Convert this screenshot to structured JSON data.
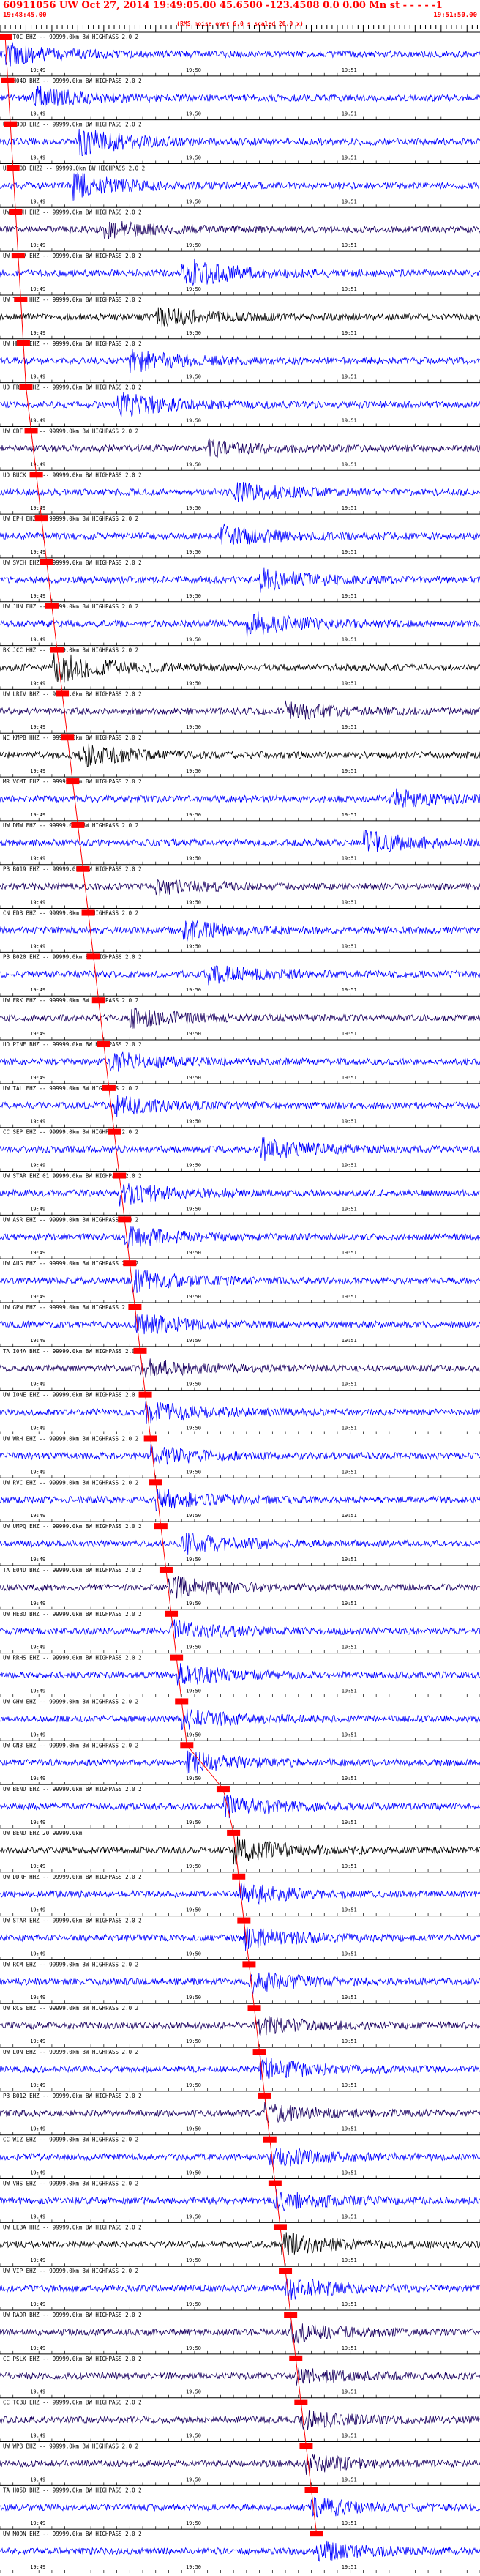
{
  "header": {
    "title": "60911056 UW Oct 27, 2014 19:49:05.00   45.6500  -123.4508  0.0 0.00 Mn st - - - - -1",
    "start_time": "19:48:45.00",
    "end_time": "19:51:50.00",
    "rms_note": "(RMS noise over 6.0 s scaled 20.0 x)"
  },
  "colors": {
    "trace_blue": "#0000ff",
    "trace_black": "#000000",
    "trace_purple": "#1a0060",
    "pick_red": "#ff0000",
    "tick_black": "#000000"
  },
  "chart_data": {
    "type": "seismogram-record-section",
    "x_range_seconds": [
      0,
      185
    ],
    "time_tick_labels": [
      "19:49",
      "19:50",
      "19:51"
    ],
    "time_tick_offsets_s": [
      15,
      75,
      135
    ],
    "traces": [
      {
        "label": "CN TOC BHZ -- 99999.0km BW  HIGHPASS  2.0  2",
        "color": "blue",
        "pick_s": 2,
        "amp": 0.55,
        "event_s": 2
      },
      {
        "label": "TA H04D BHZ -- 99999.0km BW  HIGHPASS  2.0  2",
        "color": "blue",
        "pick_s": 3,
        "amp": 0.6,
        "event_s": 12
      },
      {
        "label": "UO HOOD EHZ -- 99999.0km BW  HIGHPASS  2.0  2",
        "color": "blue",
        "pick_s": 4,
        "amp": 0.7,
        "event_s": 30
      },
      {
        "label": "UO HOOD EHZ2 -- 99999.0km BW  HIGHPASS  2.0  2",
        "color": "blue",
        "pick_s": 5,
        "amp": 0.65,
        "event_s": 28
      },
      {
        "label": "UW SPUH EHZ -- 99999.0km BW  HIGHPASS  2.0  2",
        "color": "purple",
        "pick_s": 6,
        "amp": 0.4,
        "event_s": 40
      },
      {
        "label": "UW JORV EHZ -- 99999.0km BW  HIGHPASS  2.0  2",
        "color": "blue",
        "pick_s": 7,
        "amp": 0.8,
        "event_s": 70
      },
      {
        "label": "UW TUCA HHZ -- 99999.0km BW  HIGHPASS  2.0  2",
        "color": "black",
        "pick_s": 8,
        "amp": 0.5,
        "event_s": 60
      },
      {
        "label": "UW HMRT EHZ -- 99999.0km BW  HIGHPASS  2.0  2",
        "color": "blue",
        "pick_s": 9,
        "amp": 0.6,
        "event_s": 50
      },
      {
        "label": "UO FRIS EHZ -- 99999.0km BW  HIGHPASS  2.0  2",
        "color": "blue",
        "pick_s": 10,
        "amp": 0.65,
        "event_s": 45
      },
      {
        "label": "UW CDF EHZ -- 99999.0km BW  HIGHPASS  2.0  2",
        "color": "purple",
        "pick_s": 12,
        "amp": 0.35,
        "event_s": 80
      },
      {
        "label": "UO BUCK BHZ -- 99999.0km BW  HIGHPASS  2.0  2",
        "color": "blue",
        "pick_s": 14,
        "amp": 0.5,
        "event_s": 90
      },
      {
        "label": "UW EPH EHZ -- 99999.0km BW  HIGHPASS  2.0  2",
        "color": "blue",
        "pick_s": 16,
        "amp": 0.55,
        "event_s": 85
      },
      {
        "label": "UW SVCH EHZ -- 99999.0km BW  HIGHPASS  2.0  2",
        "color": "blue",
        "pick_s": 18,
        "amp": 0.55,
        "event_s": 100
      },
      {
        "label": "UW JUN EHZ -- 99999.0km BW  HIGHPASS  2.0  2",
        "color": "blue",
        "pick_s": 20,
        "amp": 0.6,
        "event_s": 95
      },
      {
        "label": "BK JCC HHZ -- 99999.0km BW  HIGHPASS  2.0  2",
        "color": "black",
        "pick_s": 22,
        "amp": 0.85,
        "event_s": 20
      },
      {
        "label": "UW LRIV BHZ -- 99999.0km BW  HIGHPASS  2.0  2",
        "color": "purple",
        "pick_s": 24,
        "amp": 0.45,
        "event_s": 110
      },
      {
        "label": "NC KMPB HHZ -- 99999.0km BW  HIGHPASS  2.0  2",
        "color": "black",
        "pick_s": 26,
        "amp": 0.6,
        "event_s": 30
      },
      {
        "label": "MR VCMT EHZ -- 99999.0km BW  HIGHPASS  2.0  2",
        "color": "blue",
        "pick_s": 28,
        "amp": 0.5,
        "event_s": 150
      },
      {
        "label": "UW DMW EHZ -- 99999.0km BW  HIGHPASS  2.0  2",
        "color": "blue",
        "pick_s": 30,
        "amp": 0.55,
        "event_s": 140
      },
      {
        "label": "PB B019 EHZ -- 99999.0km BW  HIGHPASS  2.0  2",
        "color": "purple",
        "pick_s": 32,
        "amp": 0.4,
        "event_s": 60
      },
      {
        "label": "CN EDB BHZ -- 99999.0km BW  HIGHPASS  2.0  2",
        "color": "blue",
        "pick_s": 34,
        "amp": 0.5,
        "event_s": 70
      },
      {
        "label": "PB B020 EHZ -- 99999.0km BW  HIGHPASS  2.0  2",
        "color": "blue",
        "pick_s": 36,
        "amp": 0.45,
        "event_s": 80
      },
      {
        "label": "UW FRK EHZ -- 99999.0km BW  HIGHPASS  2.0  2",
        "color": "purple",
        "pick_s": 38,
        "amp": 0.45,
        "event_s": 50
      },
      {
        "label": "UO PINE BHZ -- 99999.0km BW  HIGHPASS  2.0  2",
        "color": "blue",
        "pick_s": 40,
        "amp": 0.55,
        "event_s": 42
      },
      {
        "label": "UW TAL EHZ -- 99999.0km BW  HIGHPASS  2.0  2",
        "color": "blue",
        "pick_s": 42,
        "amp": 0.5,
        "event_s": 44
      },
      {
        "label": "CC SEP EHZ -- 99999.0km BW  HIGHPASS  2.0  2",
        "color": "blue",
        "pick_s": 44,
        "amp": 0.55,
        "event_s": 100
      },
      {
        "label": "UW STAR EHZ 01 99999.0km BW  HIGHPASS  2.0  2",
        "color": "blue",
        "pick_s": 46,
        "amp": 0.6,
        "event_s": 46
      },
      {
        "label": "UW ASR EHZ -- 99999.0km BW  HIGHPASS  2.0  2",
        "color": "blue",
        "pick_s": 48,
        "amp": 0.55,
        "event_s": 48
      },
      {
        "label": "UW AUG EHZ -- 99999.0km BW  HIGHPASS  2.0  2",
        "color": "blue",
        "pick_s": 50,
        "amp": 0.55,
        "event_s": 50
      },
      {
        "label": "UW GPW EHZ -- 99999.0km BW  HIGHPASS  2.0  2",
        "color": "blue",
        "pick_s": 52,
        "amp": 0.55,
        "event_s": 52
      },
      {
        "label": "TA I04A BHZ -- 99999.0km BW  HIGHPASS  2.0  2",
        "color": "purple",
        "pick_s": 54,
        "amp": 0.45,
        "event_s": 54
      },
      {
        "label": "UW IONE EHZ -- 99999.0km BW  HIGHPASS  2.0  2",
        "color": "blue",
        "pick_s": 56,
        "amp": 0.55,
        "event_s": 56
      },
      {
        "label": "UW WRH EHZ -- 99999.0km BW  HIGHPASS  2.0  2",
        "color": "blue",
        "pick_s": 58,
        "amp": 0.5,
        "event_s": 58
      },
      {
        "label": "UW RVC EHZ -- 99999.0km BW  HIGHPASS  2.0  2",
        "color": "blue",
        "pick_s": 60,
        "amp": 0.5,
        "event_s": 60
      },
      {
        "label": "UW UMPQ EHZ -- 99999.0km BW  HIGHPASS  2.0  2",
        "color": "blue",
        "pick_s": 62,
        "amp": 0.55,
        "event_s": 70
      },
      {
        "label": "TA E04D BHZ -- 99999.0km BW  HIGHPASS  2.0  2",
        "color": "purple",
        "pick_s": 64,
        "amp": 0.6,
        "event_s": 64
      },
      {
        "label": "UW HEBO BHZ -- 99999.0km BW  HIGHPASS  2.0  2",
        "color": "blue",
        "pick_s": 66,
        "amp": 0.5,
        "event_s": 66
      },
      {
        "label": "UW RRHS EHZ -- 99999.0km BW  HIGHPASS  2.0  2",
        "color": "blue",
        "pick_s": 68,
        "amp": 0.55,
        "event_s": 68
      },
      {
        "label": "UW GHW EHZ -- 99999.0km BW  HIGHPASS  2.0  2",
        "color": "blue",
        "pick_s": 70,
        "amp": 0.5,
        "event_s": 70
      },
      {
        "label": "UW GN3 EHZ -- 99999.0km BW  HIGHPASS  2.0  2",
        "color": "blue",
        "pick_s": 72,
        "amp": 0.55,
        "event_s": 72
      },
      {
        "label": "UW BEND EHZ -- 99999.0km BW  HIGHPASS  2.0  2",
        "color": "blue",
        "pick_s": 86,
        "amp": 0.55,
        "event_s": 86
      },
      {
        "label": "UW BEND EHZ 20 99999.0km",
        "color": "black",
        "pick_s": 90,
        "amp": 0.7,
        "event_s": 90
      },
      {
        "label": "UW DDRF HHZ -- 99999.0km BW  HIGHPASS  2.0  2",
        "color": "blue",
        "pick_s": 92,
        "amp": 0.55,
        "event_s": 92
      },
      {
        "label": "UW STAR EHZ -- 99999.0km BW  HIGHPASS  2.0  2",
        "color": "blue",
        "pick_s": 94,
        "amp": 0.55,
        "event_s": 94
      },
      {
        "label": "UW RCM EHZ -- 99999.0km BW  HIGHPASS  2.0  2",
        "color": "blue",
        "pick_s": 96,
        "amp": 0.55,
        "event_s": 96
      },
      {
        "label": "UW RCS EHZ -- 99999.0km BW  HIGHPASS  2.0  2",
        "color": "purple",
        "pick_s": 98,
        "amp": 0.5,
        "event_s": 98
      },
      {
        "label": "UW LON BHZ -- 99999.0km BW  HIGHPASS  2.0  2",
        "color": "blue",
        "pick_s": 100,
        "amp": 0.6,
        "event_s": 100
      },
      {
        "label": "PB B012 EHZ -- 99999.0km BW  HIGHPASS  2.0  2",
        "color": "purple",
        "pick_s": 102,
        "amp": 0.45,
        "event_s": 102
      },
      {
        "label": "CC WIZ EHZ -- 99999.0km BW  HIGHPASS  2.0  2",
        "color": "blue",
        "pick_s": 104,
        "amp": 0.55,
        "event_s": 104
      },
      {
        "label": "UW VHS EHZ -- 99999.0km BW  HIGHPASS  2.0  2",
        "color": "blue",
        "pick_s": 106,
        "amp": 0.5,
        "event_s": 106
      },
      {
        "label": "UW LEBA HHZ -- 99999.0km BW  HIGHPASS  2.0  2",
        "color": "black",
        "pick_s": 108,
        "amp": 0.6,
        "event_s": 108
      },
      {
        "label": "UW VIP EHZ -- 99999.0km BW  HIGHPASS  2.0  2",
        "color": "blue",
        "pick_s": 110,
        "amp": 0.55,
        "event_s": 110
      },
      {
        "label": "UW RADR BHZ -- 99999.0km BW  HIGHPASS  2.0  2",
        "color": "purple",
        "pick_s": 112,
        "amp": 0.5,
        "event_s": 112
      },
      {
        "label": "CC PSLK EHZ -- 99999.0km BW  HIGHPASS  2.0  2",
        "color": "purple",
        "pick_s": 114,
        "amp": 0.45,
        "event_s": 114
      },
      {
        "label": "CC TCBU EHZ -- 99999.0km BW  HIGHPASS  2.0  2",
        "color": "purple",
        "pick_s": 116,
        "amp": 0.45,
        "event_s": 116
      },
      {
        "label": "UW WPB BHZ -- 99999.0km BW  HIGHPASS  2.0  2",
        "color": "purple",
        "pick_s": 118,
        "amp": 0.45,
        "event_s": 118
      },
      {
        "label": "TA H05D BHZ -- 99999.0km BW  HIGHPASS  2.0  2",
        "color": "blue",
        "pick_s": 120,
        "amp": 0.5,
        "event_s": 120
      },
      {
        "label": "UW MOON EHZ -- 99999.0km BW  HIGHPASS  2.0  2",
        "color": "blue",
        "pick_s": 122,
        "amp": 0.5,
        "event_s": 122
      }
    ]
  }
}
